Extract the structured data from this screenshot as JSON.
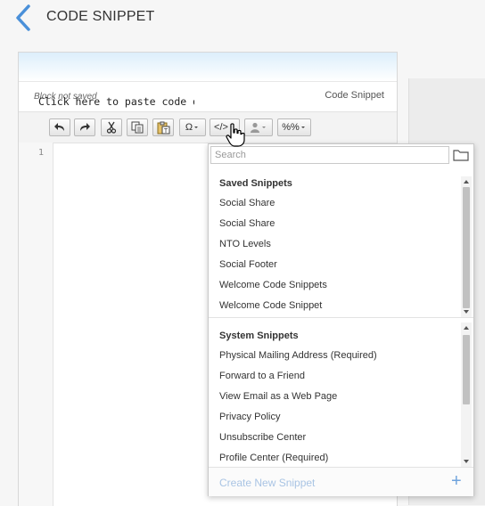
{
  "header": {
    "title": "CODE SNIPPET"
  },
  "panel": {
    "status": "Block not saved",
    "title": "Code Snippet"
  },
  "toolbar": {
    "omega": "Ω",
    "code": "</>",
    "percent": "%%"
  },
  "editor": {
    "line_number": "1",
    "text": "Click here to paste code d"
  },
  "dropdown": {
    "search_placeholder": "Search",
    "saved_heading": "Saved Snippets",
    "saved": [
      "Social Share",
      "Social Share",
      "NTO Levels",
      "Social Footer",
      "Welcome Code Snippets",
      "Welcome Code Snippet"
    ],
    "system_heading": "System Snippets",
    "system": [
      "Physical Mailing Address (Required)",
      "Forward to a Friend",
      "View Email as a Web Page",
      "Privacy Policy",
      "Unsubscribe Center",
      "Profile Center (Required)"
    ],
    "create_label": "Create New Snippet",
    "plus": "+"
  },
  "colors": {
    "accent": "#4a90d9",
    "create_link": "#a9c4e4"
  }
}
